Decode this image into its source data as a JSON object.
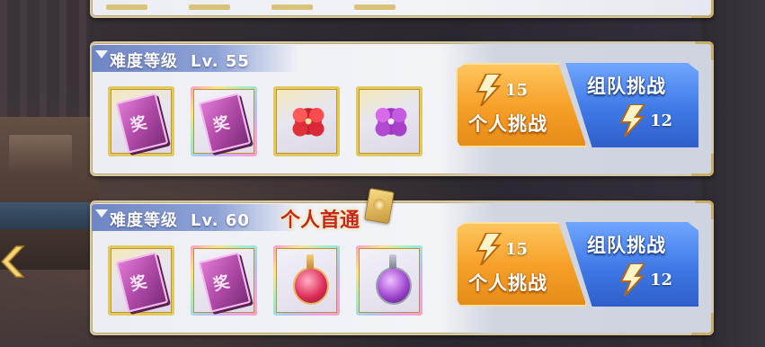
{
  "stages": [
    {
      "difficulty_label": "难度等级",
      "level": "Lv. 55",
      "first_clear_badge": "",
      "rewards": [
        {
          "icon": "pink-book-icon",
          "rarity": "gold"
        },
        {
          "icon": "pink-book-rainbow-icon",
          "rarity": "rainbow"
        },
        {
          "icon": "red-flower-icon",
          "rarity": "gold"
        },
        {
          "icon": "purple-flower-icon",
          "rarity": "gold"
        }
      ],
      "solo": {
        "label": "个人挑战",
        "cost": "15"
      },
      "team": {
        "label": "组队挑战",
        "cost": "12"
      }
    },
    {
      "difficulty_label": "难度等级",
      "level": "Lv. 60",
      "first_clear_badge": "个人首通",
      "rewards": [
        {
          "icon": "pink-book-icon",
          "rarity": "gold"
        },
        {
          "icon": "pink-book-rainbow-icon",
          "rarity": "rainbow"
        },
        {
          "icon": "red-potion-icon",
          "rarity": "rainbow"
        },
        {
          "icon": "violet-potion-icon",
          "rarity": "rainbow"
        }
      ],
      "solo": {
        "label": "个人挑战",
        "cost": "15"
      },
      "team": {
        "label": "组队挑战",
        "cost": "12"
      }
    }
  ],
  "colors": {
    "solo_button": "#f6a12a",
    "team_button": "#3f79e6",
    "header": "#7a90c9",
    "first_clear_text": "#c2281d"
  }
}
